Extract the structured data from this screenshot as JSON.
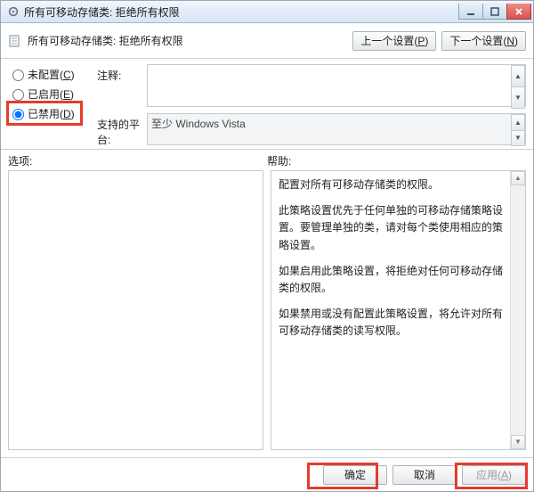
{
  "window": {
    "title": "所有可移动存储类: 拒绝所有权限",
    "buttons": {
      "min": "min",
      "max": "max",
      "close": "close"
    }
  },
  "header": {
    "policy_name": "所有可移动存储类: 拒绝所有权限",
    "prev_label": "上一个设置(P)",
    "next_label": "下一个设置(N)"
  },
  "radios": {
    "not_configured": {
      "label": "未配置",
      "hotkey": "C"
    },
    "enabled": {
      "label": "已启用",
      "hotkey": "E"
    },
    "disabled": {
      "label": "已禁用",
      "hotkey": "D"
    }
  },
  "fields": {
    "comment_label": "注释:",
    "comment_value": "",
    "platform_label": "支持的平台:",
    "platform_value": "至少 Windows Vista"
  },
  "lower": {
    "options_label": "选项:",
    "help_label": "帮助:"
  },
  "help_text": {
    "p1": "配置对所有可移动存储类的权限。",
    "p2": "此策略设置优先于任何单独的可移动存储策略设置。要管理单独的类，请对每个类使用相应的策略设置。",
    "p3": "如果启用此策略设置，将拒绝对任何可移动存储类的权限。",
    "p4": "如果禁用或没有配置此策略设置，将允许对所有可移动存储类的读写权限。"
  },
  "buttons": {
    "ok": "确定",
    "cancel": "取消",
    "apply_label": "应用",
    "apply_hotkey": "A"
  }
}
